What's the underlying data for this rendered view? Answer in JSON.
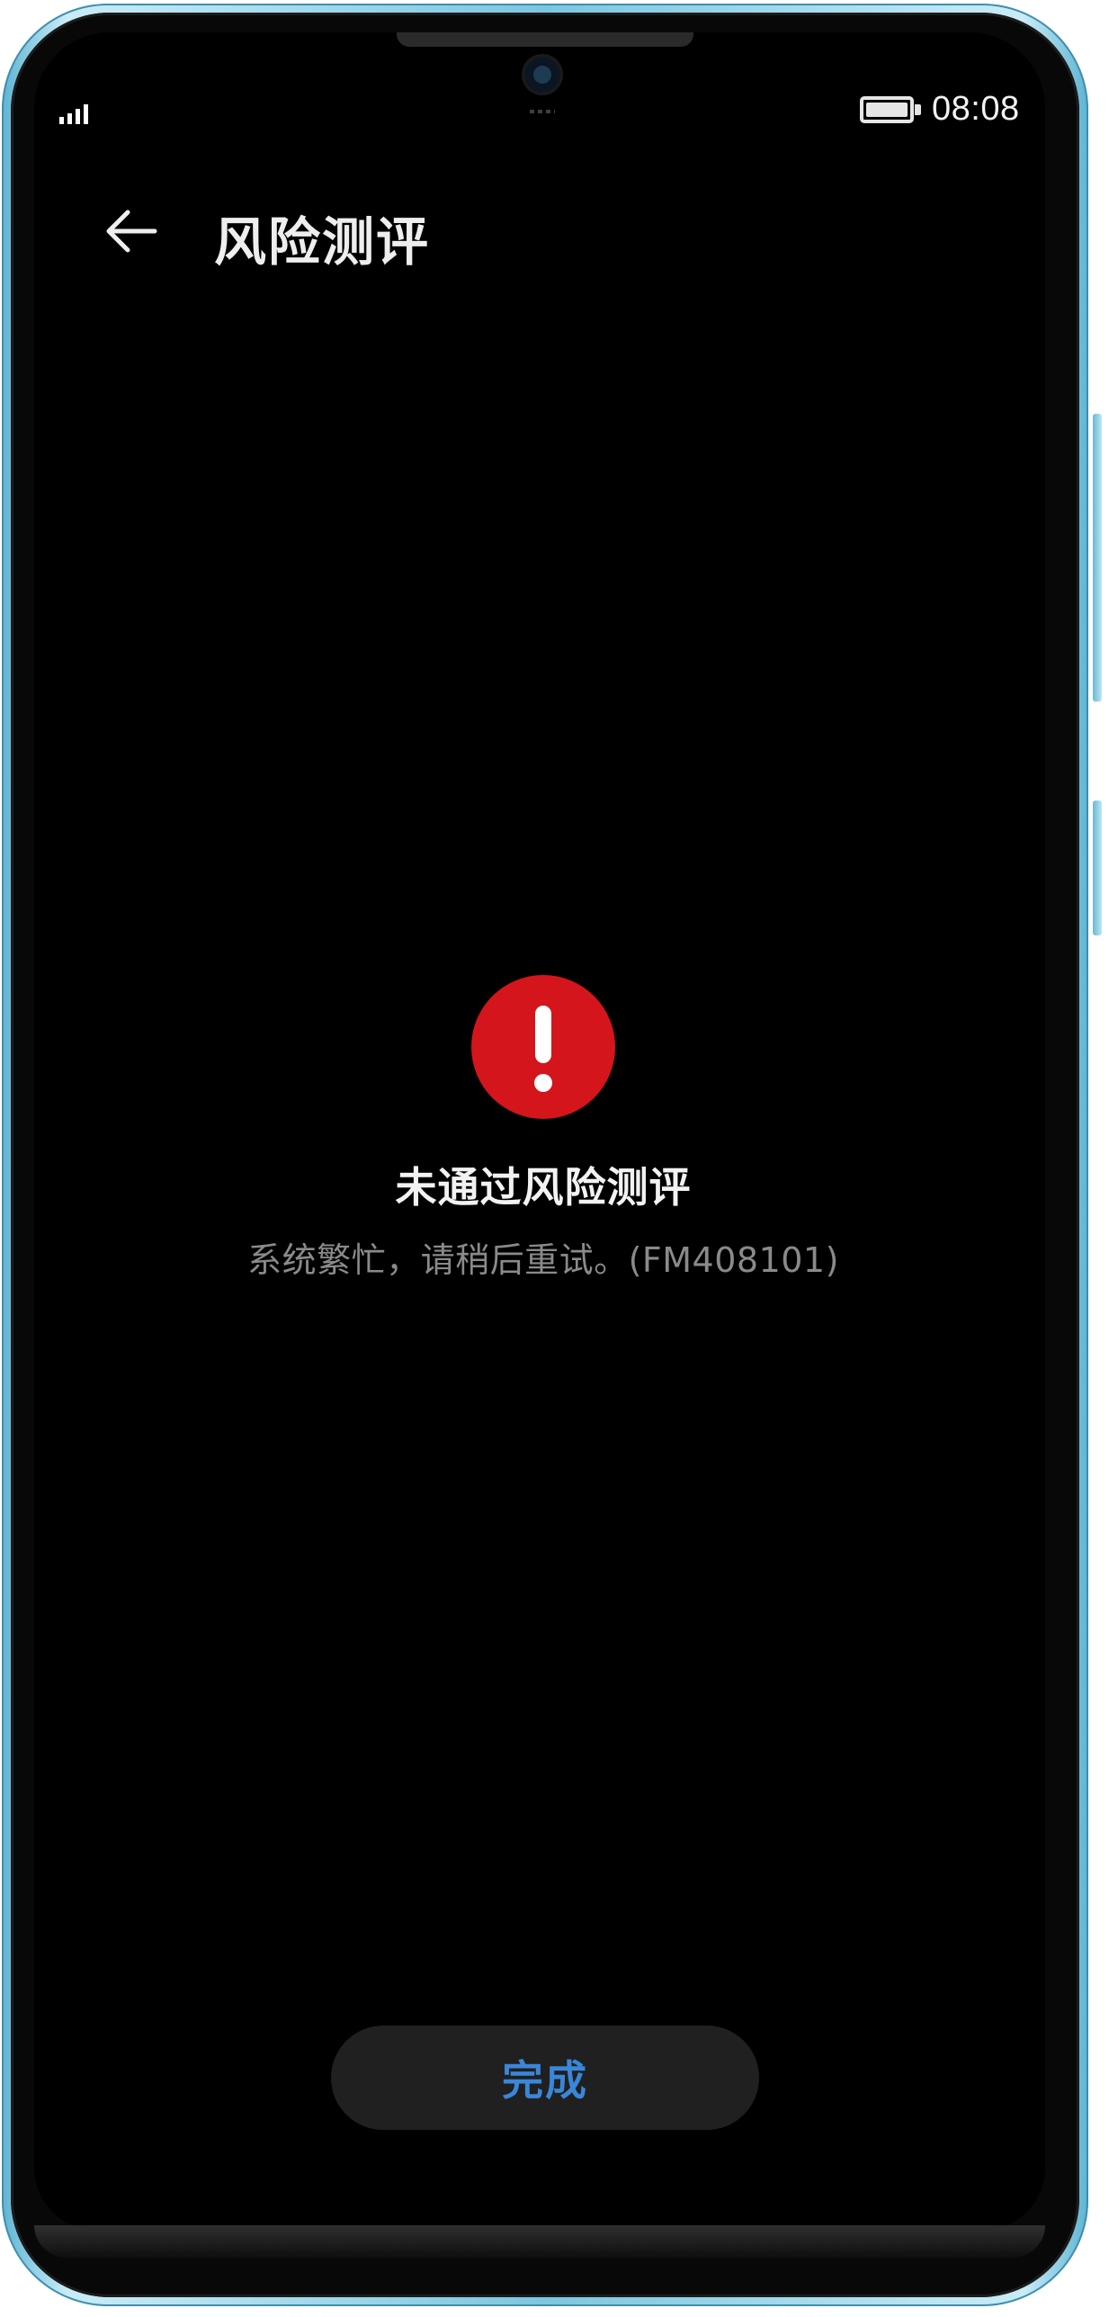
{
  "status_bar": {
    "time": "08:08",
    "signal_icon": "signal-bars-icon",
    "battery_icon": "battery-full-icon"
  },
  "header": {
    "back_icon": "arrow-left-icon",
    "title": "风险测评"
  },
  "result": {
    "icon": "exclamation-circle-icon",
    "icon_color": "#d4151b",
    "title": "未通过风险测评",
    "message": "系统繁忙，请稍后重试。(FM408101)"
  },
  "footer": {
    "done_label": "完成",
    "done_color": "#3a86d8"
  }
}
